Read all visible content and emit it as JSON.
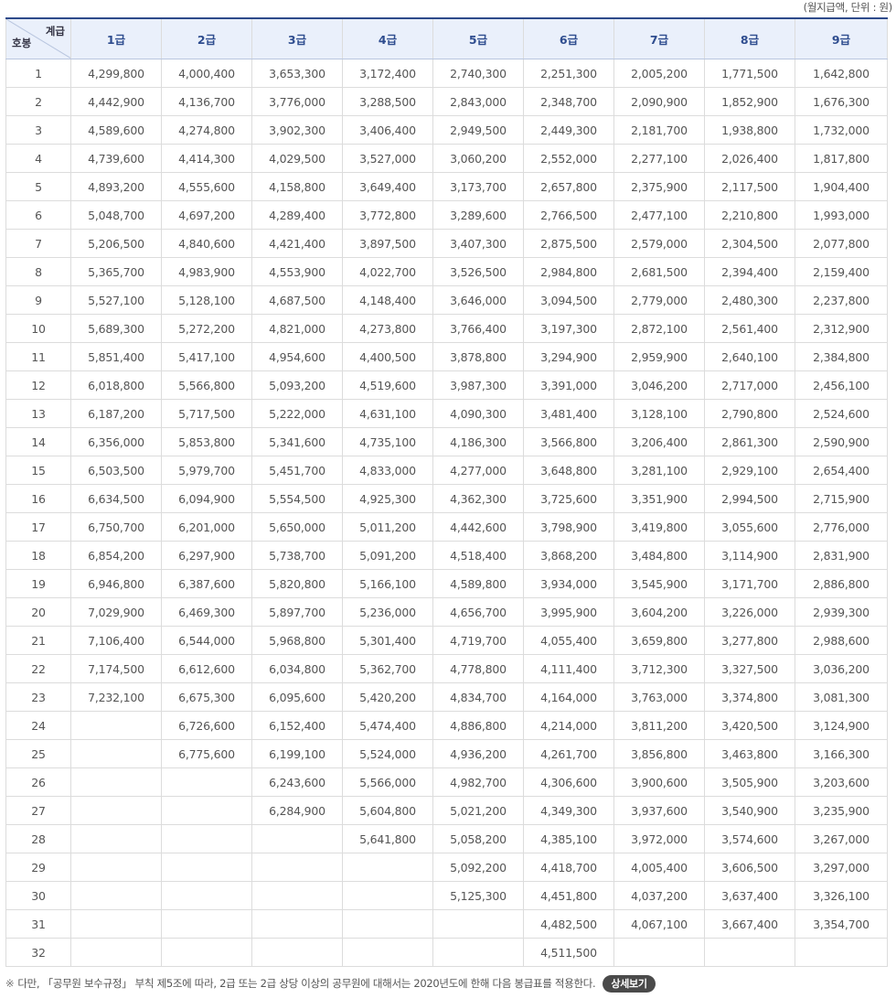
{
  "unit_note": "(월지급액, 단위 : 원)",
  "header": {
    "corner_top": "계급",
    "corner_bottom": "호봉",
    "grades": [
      "1급",
      "2급",
      "3급",
      "4급",
      "5급",
      "6급",
      "7급",
      "8급",
      "9급"
    ]
  },
  "rows": [
    [
      "1",
      "4,299,800",
      "4,000,400",
      "3,653,300",
      "3,172,400",
      "2,740,300",
      "2,251,300",
      "2,005,200",
      "1,771,500",
      "1,642,800"
    ],
    [
      "2",
      "4,442,900",
      "4,136,700",
      "3,776,000",
      "3,288,500",
      "2,843,000",
      "2,348,700",
      "2,090,900",
      "1,852,900",
      "1,676,300"
    ],
    [
      "3",
      "4,589,600",
      "4,274,800",
      "3,902,300",
      "3,406,400",
      "2,949,500",
      "2,449,300",
      "2,181,700",
      "1,938,800",
      "1,732,000"
    ],
    [
      "4",
      "4,739,600",
      "4,414,300",
      "4,029,500",
      "3,527,000",
      "3,060,200",
      "2,552,000",
      "2,277,100",
      "2,026,400",
      "1,817,800"
    ],
    [
      "5",
      "4,893,200",
      "4,555,600",
      "4,158,800",
      "3,649,400",
      "3,173,700",
      "2,657,800",
      "2,375,900",
      "2,117,500",
      "1,904,400"
    ],
    [
      "6",
      "5,048,700",
      "4,697,200",
      "4,289,400",
      "3,772,800",
      "3,289,600",
      "2,766,500",
      "2,477,100",
      "2,210,800",
      "1,993,000"
    ],
    [
      "7",
      "5,206,500",
      "4,840,600",
      "4,421,400",
      "3,897,500",
      "3,407,300",
      "2,875,500",
      "2,579,000",
      "2,304,500",
      "2,077,800"
    ],
    [
      "8",
      "5,365,700",
      "4,983,900",
      "4,553,900",
      "4,022,700",
      "3,526,500",
      "2,984,800",
      "2,681,500",
      "2,394,400",
      "2,159,400"
    ],
    [
      "9",
      "5,527,100",
      "5,128,100",
      "4,687,500",
      "4,148,400",
      "3,646,000",
      "3,094,500",
      "2,779,000",
      "2,480,300",
      "2,237,800"
    ],
    [
      "10",
      "5,689,300",
      "5,272,200",
      "4,821,000",
      "4,273,800",
      "3,766,400",
      "3,197,300",
      "2,872,100",
      "2,561,400",
      "2,312,900"
    ],
    [
      "11",
      "5,851,400",
      "5,417,100",
      "4,954,600",
      "4,400,500",
      "3,878,800",
      "3,294,900",
      "2,959,900",
      "2,640,100",
      "2,384,800"
    ],
    [
      "12",
      "6,018,800",
      "5,566,800",
      "5,093,200",
      "4,519,600",
      "3,987,300",
      "3,391,000",
      "3,046,200",
      "2,717,000",
      "2,456,100"
    ],
    [
      "13",
      "6,187,200",
      "5,717,500",
      "5,222,000",
      "4,631,100",
      "4,090,300",
      "3,481,400",
      "3,128,100",
      "2,790,800",
      "2,524,600"
    ],
    [
      "14",
      "6,356,000",
      "5,853,800",
      "5,341,600",
      "4,735,100",
      "4,186,300",
      "3,566,800",
      "3,206,400",
      "2,861,300",
      "2,590,900"
    ],
    [
      "15",
      "6,503,500",
      "5,979,700",
      "5,451,700",
      "4,833,000",
      "4,277,000",
      "3,648,800",
      "3,281,100",
      "2,929,100",
      "2,654,400"
    ],
    [
      "16",
      "6,634,500",
      "6,094,900",
      "5,554,500",
      "4,925,300",
      "4,362,300",
      "3,725,600",
      "3,351,900",
      "2,994,500",
      "2,715,900"
    ],
    [
      "17",
      "6,750,700",
      "6,201,000",
      "5,650,000",
      "5,011,200",
      "4,442,600",
      "3,798,900",
      "3,419,800",
      "3,055,600",
      "2,776,000"
    ],
    [
      "18",
      "6,854,200",
      "6,297,900",
      "5,738,700",
      "5,091,200",
      "4,518,400",
      "3,868,200",
      "3,484,800",
      "3,114,900",
      "2,831,900"
    ],
    [
      "19",
      "6,946,800",
      "6,387,600",
      "5,820,800",
      "5,166,100",
      "4,589,800",
      "3,934,000",
      "3,545,900",
      "3,171,700",
      "2,886,800"
    ],
    [
      "20",
      "7,029,900",
      "6,469,300",
      "5,897,700",
      "5,236,000",
      "4,656,700",
      "3,995,900",
      "3,604,200",
      "3,226,000",
      "2,939,300"
    ],
    [
      "21",
      "7,106,400",
      "6,544,000",
      "5,968,800",
      "5,301,400",
      "4,719,700",
      "4,055,400",
      "3,659,800",
      "3,277,800",
      "2,988,600"
    ],
    [
      "22",
      "7,174,500",
      "6,612,600",
      "6,034,800",
      "5,362,700",
      "4,778,800",
      "4,111,400",
      "3,712,300",
      "3,327,500",
      "3,036,200"
    ],
    [
      "23",
      "7,232,100",
      "6,675,300",
      "6,095,600",
      "5,420,200",
      "4,834,700",
      "4,164,000",
      "3,763,000",
      "3,374,800",
      "3,081,300"
    ],
    [
      "24",
      "",
      "6,726,600",
      "6,152,400",
      "5,474,400",
      "4,886,800",
      "4,214,000",
      "3,811,200",
      "3,420,500",
      "3,124,900"
    ],
    [
      "25",
      "",
      "6,775,600",
      "6,199,100",
      "5,524,000",
      "4,936,200",
      "4,261,700",
      "3,856,800",
      "3,463,800",
      "3,166,300"
    ],
    [
      "26",
      "",
      "",
      "6,243,600",
      "5,566,000",
      "4,982,700",
      "4,306,600",
      "3,900,600",
      "3,505,900",
      "3,203,600"
    ],
    [
      "27",
      "",
      "",
      "6,284,900",
      "5,604,800",
      "5,021,200",
      "4,349,300",
      "3,937,600",
      "3,540,900",
      "3,235,900"
    ],
    [
      "28",
      "",
      "",
      "",
      "5,641,800",
      "5,058,200",
      "4,385,100",
      "3,972,000",
      "3,574,600",
      "3,267,000"
    ],
    [
      "29",
      "",
      "",
      "",
      "",
      "5,092,200",
      "4,418,700",
      "4,005,400",
      "3,606,500",
      "3,297,000"
    ],
    [
      "30",
      "",
      "",
      "",
      "",
      "5,125,300",
      "4,451,800",
      "4,037,200",
      "3,637,400",
      "3,326,100"
    ],
    [
      "31",
      "",
      "",
      "",
      "",
      "",
      "4,482,500",
      "4,067,100",
      "3,667,400",
      "3,354,700"
    ],
    [
      "32",
      "",
      "",
      "",
      "",
      "",
      "4,511,500",
      "",
      "",
      ""
    ]
  ],
  "footnote": {
    "mark": "※",
    "text": "다만, 「공무원 보수규정」 부칙 제5조에 따라, 2급 또는 2급 상당 이상의 공무원에 대해서는 2020년도에 한해 다음 봉급표를 적용한다.",
    "button_label": "상세보기"
  }
}
